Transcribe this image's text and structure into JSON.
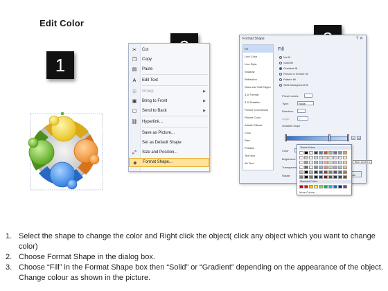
{
  "title": "Edit Color",
  "badges": [
    "1",
    "2",
    "3"
  ],
  "context_menu": {
    "items": [
      {
        "label": "Cut",
        "icon": "scissors-icon",
        "glyph": "✂",
        "disabled": false,
        "submenu": false
      },
      {
        "label": "Copy",
        "icon": "copy-icon",
        "glyph": "❐",
        "disabled": false,
        "submenu": false
      },
      {
        "label": "Paste",
        "icon": "paste-icon",
        "glyph": "▤",
        "disabled": false,
        "submenu": false
      },
      {
        "label": "Edit Text",
        "icon": "edit-text-icon",
        "glyph": "A",
        "disabled": false,
        "submenu": false
      },
      {
        "label": "Group",
        "icon": "group-icon",
        "glyph": "⊞",
        "disabled": true,
        "submenu": true
      },
      {
        "label": "Bring to Front",
        "icon": "bring-to-front-icon",
        "glyph": "▣",
        "disabled": false,
        "submenu": true
      },
      {
        "label": "Send to Back",
        "icon": "send-to-back-icon",
        "glyph": "▢",
        "disabled": false,
        "submenu": true
      },
      {
        "label": "Hyperlink...",
        "icon": "hyperlink-icon",
        "glyph": "⛓",
        "disabled": false,
        "submenu": false
      },
      {
        "label": "Save as Picture...",
        "icon": "",
        "glyph": "",
        "disabled": false,
        "submenu": false
      },
      {
        "label": "Set as Default Shape",
        "icon": "",
        "glyph": "",
        "disabled": false,
        "submenu": false
      },
      {
        "label": "Size and Position...",
        "icon": "size-position-icon",
        "glyph": "⤢",
        "disabled": false,
        "submenu": false
      },
      {
        "label": "Format Shape...",
        "icon": "format-shape-icon",
        "glyph": "◈",
        "disabled": false,
        "submenu": false
      }
    ]
  },
  "format_dialog": {
    "title": "Format Shape",
    "window_buttons": "? ✕",
    "categories": [
      "Fill",
      "Line Color",
      "Line Style",
      "Shadow",
      "Reflection",
      "Glow and Soft Edges",
      "3-D Format",
      "3-D Rotation",
      "Picture Corrections",
      "Picture Color",
      "Artistic Effects",
      "Crop",
      "Size",
      "Position",
      "Text Box",
      "Alt Text"
    ],
    "selected_category": "Fill",
    "heading": "Fill",
    "fill_options": [
      "No fill",
      "Solid fill",
      "Gradient fill",
      "Picture or texture fill",
      "Pattern fill",
      "Slide background fill"
    ],
    "selected_fill": "Gradient fill",
    "fields": {
      "preset_label": "Preset colors:",
      "type_label": "Type:",
      "type_value": "Radial",
      "direction_label": "Direction:",
      "angle_label": "Angle:",
      "angle_value": "0°",
      "stops_label": "Gradient stops",
      "color_label": "Color",
      "position_label": "Position:",
      "position_value": "71%",
      "brightness_label": "Brightness:",
      "transparency_label": "Transparency:",
      "rotate_label": "Rotate"
    },
    "close_label": "Close"
  },
  "palette": {
    "theme_label": "Theme Colors",
    "standard_label": "Standard Colors",
    "more_label": "More Colors...",
    "tooltip": "Blue, Accent 1",
    "theme_top": [
      "#ffffff",
      "#000000",
      "#eeece1",
      "#1f497d",
      "#4f81bd",
      "#c0504d",
      "#9bbb59",
      "#8064a2",
      "#4bacc6",
      "#f79646"
    ],
    "standard": [
      "#c00000",
      "#ff0000",
      "#ffc000",
      "#ffff00",
      "#92d050",
      "#00b050",
      "#00b0f0",
      "#0070c0",
      "#002060",
      "#7030a0"
    ]
  },
  "instructions": [
    {
      "num": "1.",
      "text": "Select the shape to change the color and Right click the object( click any object which you want to change color)"
    },
    {
      "num": "2.",
      "text": "Choose Format Shape in the dialog box."
    },
    {
      "num": "3.",
      "text": "Choose “Fill” in the Format Shape box then “Solid” or “Gradient” depending on the appearance of the object. Change colour as shown in the picture."
    }
  ]
}
